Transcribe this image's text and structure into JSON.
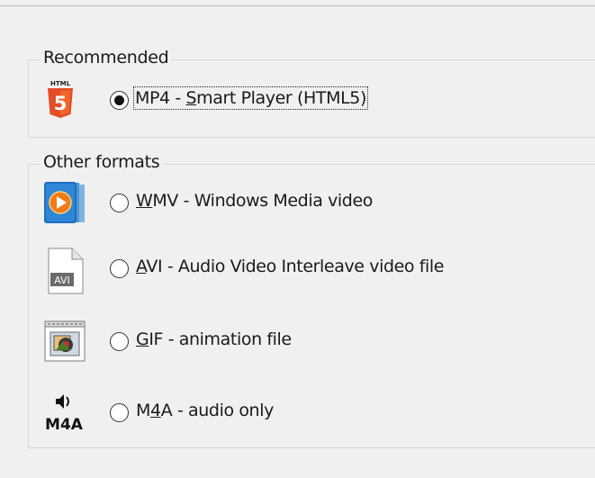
{
  "groups": {
    "recommended": {
      "legend": "Recommended",
      "options": [
        {
          "id": "mp4",
          "mnemonic": "S",
          "label_pre": "MP4 - ",
          "label_post": "mart Player (HTML5)",
          "checked": true,
          "icon": "html5-icon"
        }
      ]
    },
    "other": {
      "legend": "Other formats",
      "options": [
        {
          "id": "wmv",
          "mnemonic": "W",
          "label_pre": "",
          "label_post": "MV - Windows Media video",
          "checked": false,
          "icon": "windows-media-icon"
        },
        {
          "id": "avi",
          "mnemonic": "A",
          "label_pre": "",
          "label_post": "VI - Audio Video Interleave video file",
          "checked": false,
          "icon": "avi-file-icon"
        },
        {
          "id": "gif",
          "mnemonic": "G",
          "label_pre": "",
          "label_post": "IF - animation file",
          "checked": false,
          "icon": "gif-animation-icon"
        },
        {
          "id": "m4a",
          "mnemonic": "4",
          "label_pre": "M",
          "label_post": "A - audio only",
          "checked": false,
          "icon": "m4a-audio-icon"
        }
      ]
    }
  },
  "icons": {
    "avi_text": "AVI",
    "m4a_text": "M4A",
    "html5_text": "HTML",
    "html5_digit": "5"
  },
  "colors": {
    "html5_orange": "#e44d26",
    "wmp_orange": "#f07b18",
    "wmp_blue": "#1e6fbf"
  }
}
